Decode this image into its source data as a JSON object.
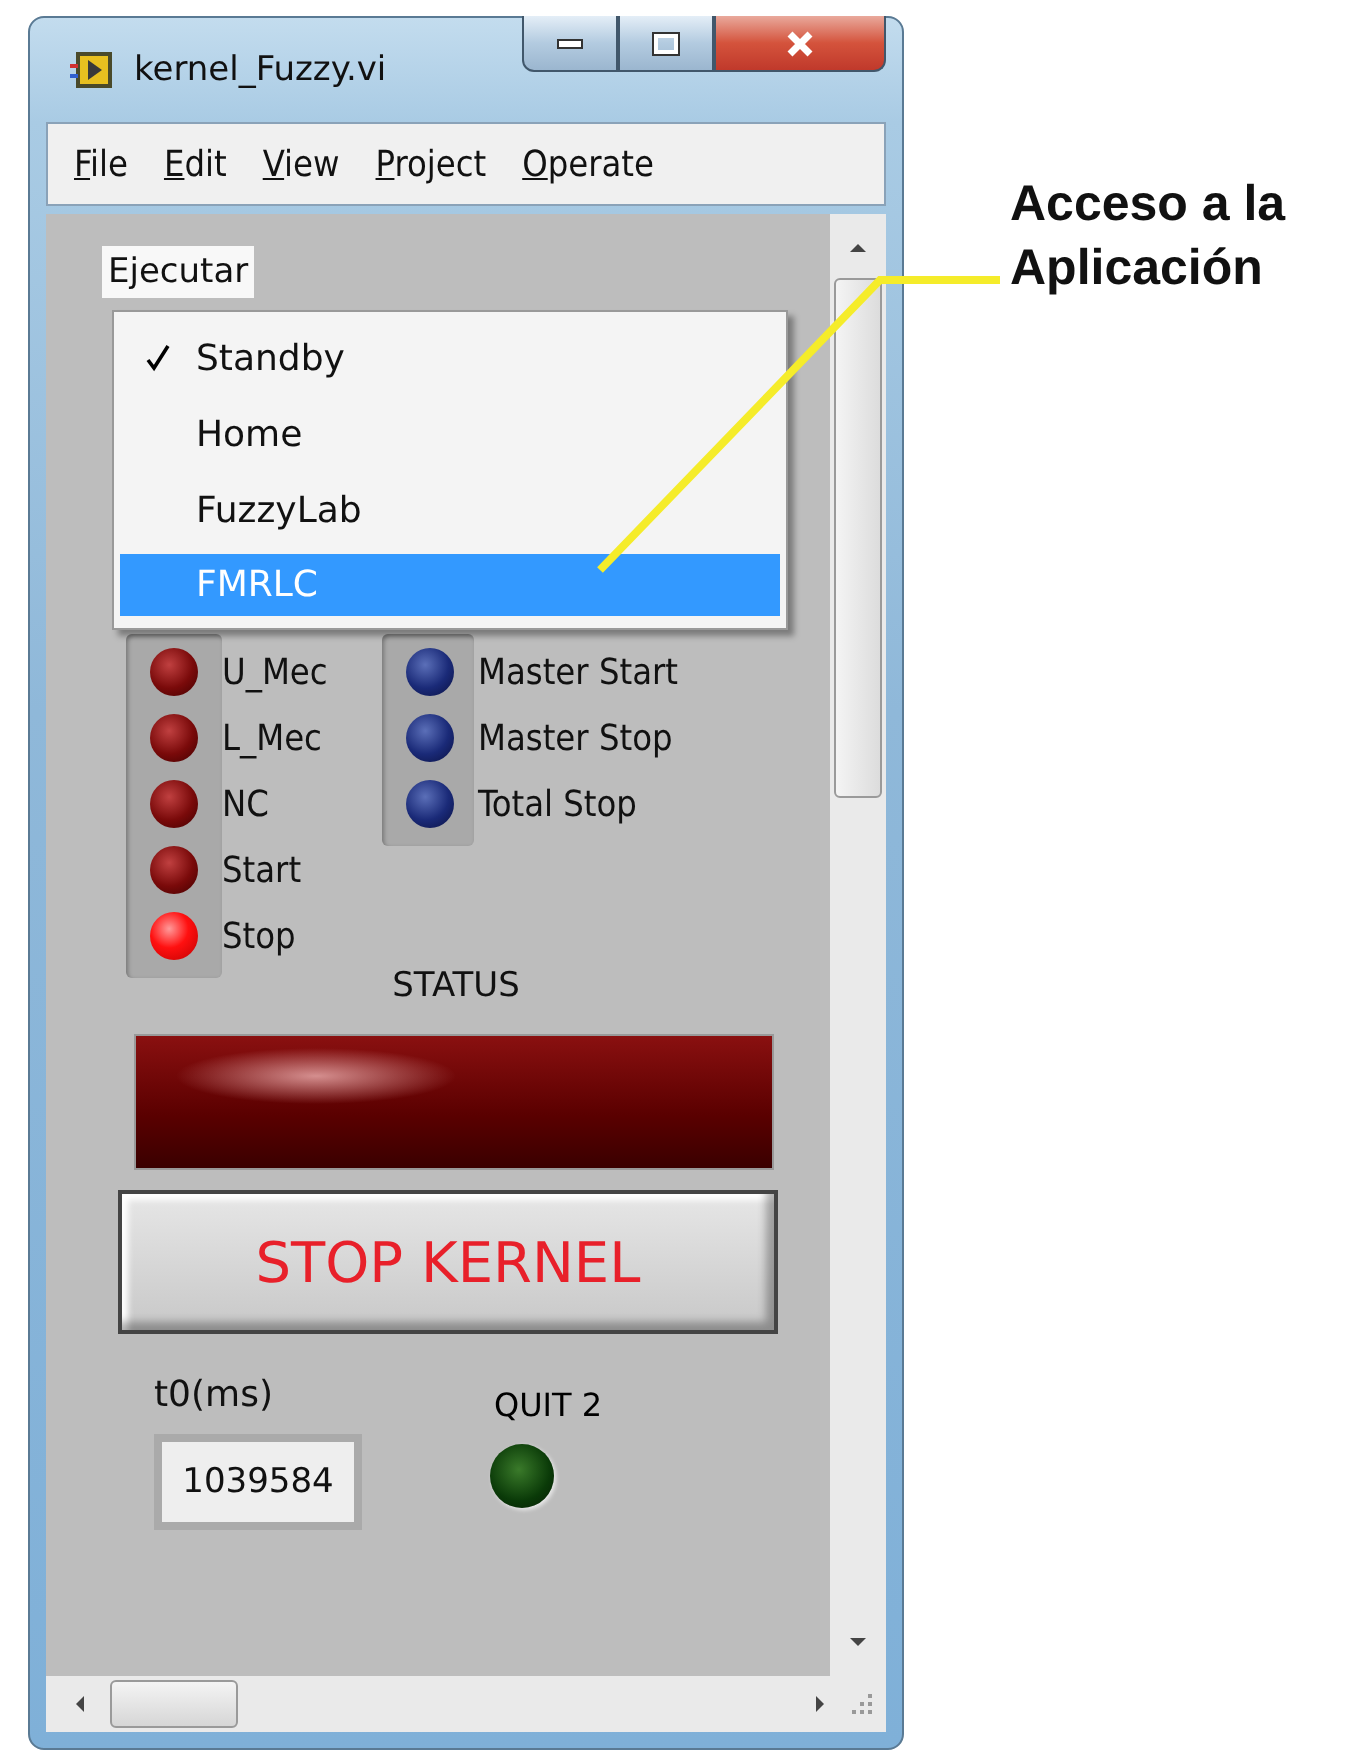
{
  "window": {
    "title": "kernel_Fuzzy.vi"
  },
  "menu": [
    "File",
    "Edit",
    "View",
    "Project",
    "Operate"
  ],
  "ring": {
    "label": "Ejecutar",
    "open": true
  },
  "dropdown": [
    {
      "label": "Standby",
      "checked": true,
      "selected": false
    },
    {
      "label": "Home",
      "checked": false,
      "selected": false
    },
    {
      "label": "FuzzyLab",
      "checked": false,
      "selected": false
    },
    {
      "label": "FMRLC",
      "checked": false,
      "selected": true
    }
  ],
  "led_groups": [
    {
      "kind": "red",
      "leds": [
        {
          "label": "U_Mec",
          "on": false
        },
        {
          "label": "L_Mec",
          "on": false
        },
        {
          "label": "NC",
          "on": false
        },
        {
          "label": "Start",
          "on": false
        },
        {
          "label": "Stop",
          "on": true
        }
      ]
    },
    {
      "kind": "blue",
      "leds": [
        {
          "label": "Master Start",
          "on": false
        },
        {
          "label": "Master Stop",
          "on": false
        },
        {
          "label": "Total Stop",
          "on": false
        }
      ]
    }
  ],
  "status": {
    "label": "STATUS",
    "on": false
  },
  "stop_button": {
    "label": "STOP KERNEL"
  },
  "t0": {
    "label": "t0(ms)",
    "value": "1039584"
  },
  "quit": {
    "label": "QUIT 2",
    "on": false
  },
  "annotation": {
    "lines": [
      "Acceso a la",
      "Aplicación"
    ]
  }
}
